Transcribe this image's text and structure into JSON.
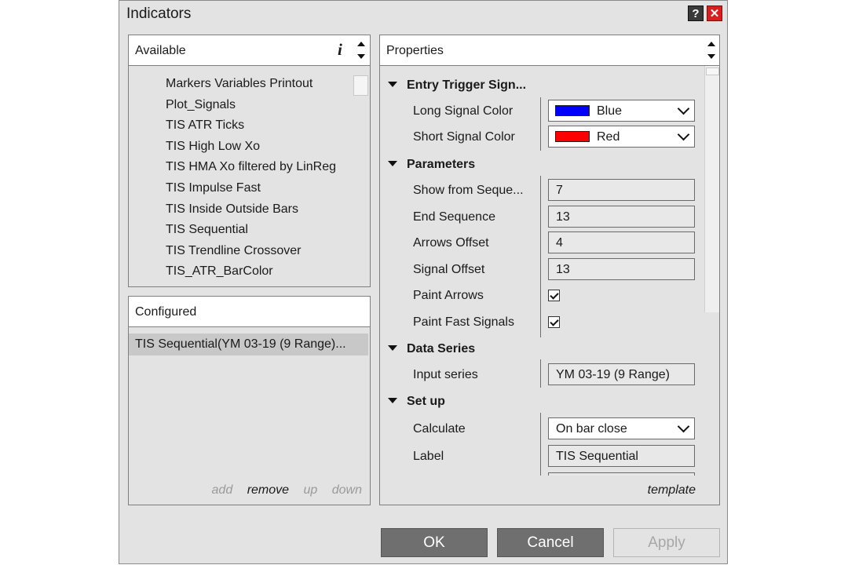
{
  "window": {
    "title": "Indicators",
    "help_label": "?",
    "close_label": "✕"
  },
  "available": {
    "header": "Available",
    "info_label": "i",
    "items": [
      "Markers Variables Printout",
      "Plot_Signals",
      "TIS ATR Ticks",
      "TIS High Low Xo",
      "TIS HMA Xo filtered by LinReg",
      "TIS Impulse Fast",
      "TIS Inside Outside Bars",
      "TIS Sequential",
      "TIS Trendline Crossover",
      "TIS_ATR_BarColor"
    ]
  },
  "configured": {
    "header": "Configured",
    "items": [
      "TIS Sequential(YM 03-19 (9 Range)..."
    ],
    "actions": {
      "add": "add",
      "remove": "remove",
      "up": "up",
      "down": "down"
    }
  },
  "properties": {
    "header": "Properties",
    "template_label": "template",
    "categories": {
      "entry": "Entry Trigger Sign...",
      "parameters": "Parameters",
      "data_series": "Data Series",
      "setup": "Set up"
    },
    "long_signal_color": {
      "label": "Long Signal Color",
      "value": "Blue",
      "color": "#0000ff"
    },
    "short_signal_color": {
      "label": "Short Signal Color",
      "value": "Red",
      "color": "#ff0000"
    },
    "show_from_sequence": {
      "label": "Show from Seque...",
      "value": "7"
    },
    "end_sequence": {
      "label": "End Sequence",
      "value": "13"
    },
    "arrows_offset": {
      "label": "Arrows Offset",
      "value": "4"
    },
    "signal_offset": {
      "label": "Signal Offset",
      "value": "13"
    },
    "paint_arrows": {
      "label": "Paint Arrows",
      "checked": true
    },
    "paint_fast_signals": {
      "label": "Paint Fast Signals",
      "checked": true
    },
    "input_series": {
      "label": "Input series",
      "value": "YM 03-19 (9 Range)"
    },
    "calculate": {
      "label": "Calculate",
      "value": "On bar close"
    },
    "label": {
      "label": "Label",
      "value": "TIS Sequential"
    }
  },
  "buttons": {
    "ok": "OK",
    "cancel": "Cancel",
    "apply": "Apply"
  }
}
